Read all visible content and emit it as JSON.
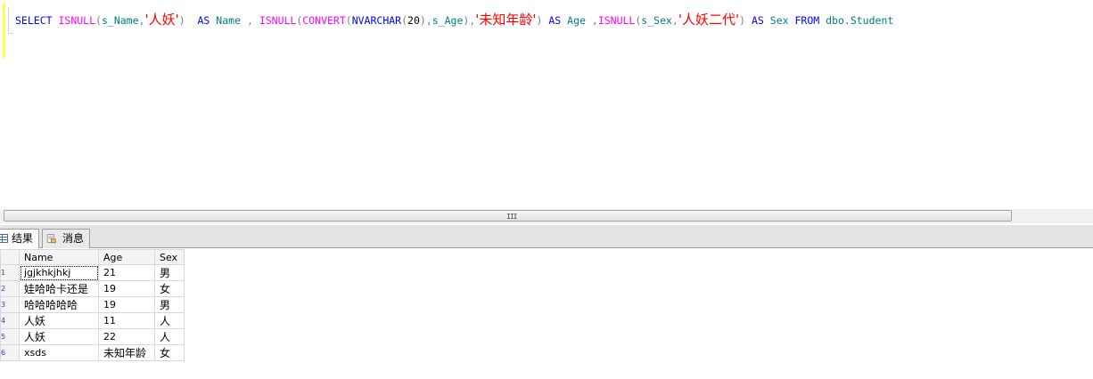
{
  "editor": {
    "tokens": {
      "select": "SELECT",
      "isnull1": "ISNULL",
      "p1": "(",
      "s_name": "s_Name",
      "comma1": ",",
      "str1": "'人妖'",
      "p2": ")",
      "as1": "AS",
      "name": "Name",
      "comma2": ",",
      "isnull2": "ISNULL",
      "p3": "(",
      "convert": "CONVERT",
      "p4": "(",
      "nvarchar": "NVARCHAR",
      "p5": "(",
      "twenty": "20",
      "p6": "),",
      "s_age": "s_Age",
      "p7": "),",
      "str2": "'未知年龄'",
      "p8": ")",
      "as2": "AS",
      "age": "Age",
      "comma3": ",",
      "isnull3": "ISNULL",
      "p9": "(",
      "s_sex": "s_Sex",
      "comma4": ",",
      "str3": "'人妖二代'",
      "p10": ")",
      "as3": "AS",
      "sex": "Sex",
      "from": "FROM",
      "table": "dbo.Student"
    }
  },
  "scrollbar": {
    "grip": "III"
  },
  "tabs": [
    {
      "label": "结果",
      "icon": "results-grid-icon",
      "active": true
    },
    {
      "label": "消息",
      "icon": "messages-icon",
      "active": false
    }
  ],
  "results": {
    "columns": [
      "Name",
      "Age",
      "Sex"
    ],
    "row_numbers": [
      "1",
      "2",
      "3",
      "4",
      "5",
      "6"
    ],
    "rows": [
      [
        "jgjkhkjhkj",
        "21",
        "男"
      ],
      [
        "娃哈哈卡还是",
        "19",
        "女"
      ],
      [
        "哈哈哈哈哈",
        "19",
        "男"
      ],
      [
        "人妖",
        "11",
        "人"
      ],
      [
        "人妖",
        "22",
        "人"
      ],
      [
        "xsds",
        "未知年龄",
        "女"
      ]
    ]
  },
  "colors": {
    "keyword": "#0000ff",
    "function": "#ff00ff",
    "string": "#ff0000",
    "identifier": "#008080",
    "operator": "#808080",
    "edit_marker": "#ffff4a"
  }
}
